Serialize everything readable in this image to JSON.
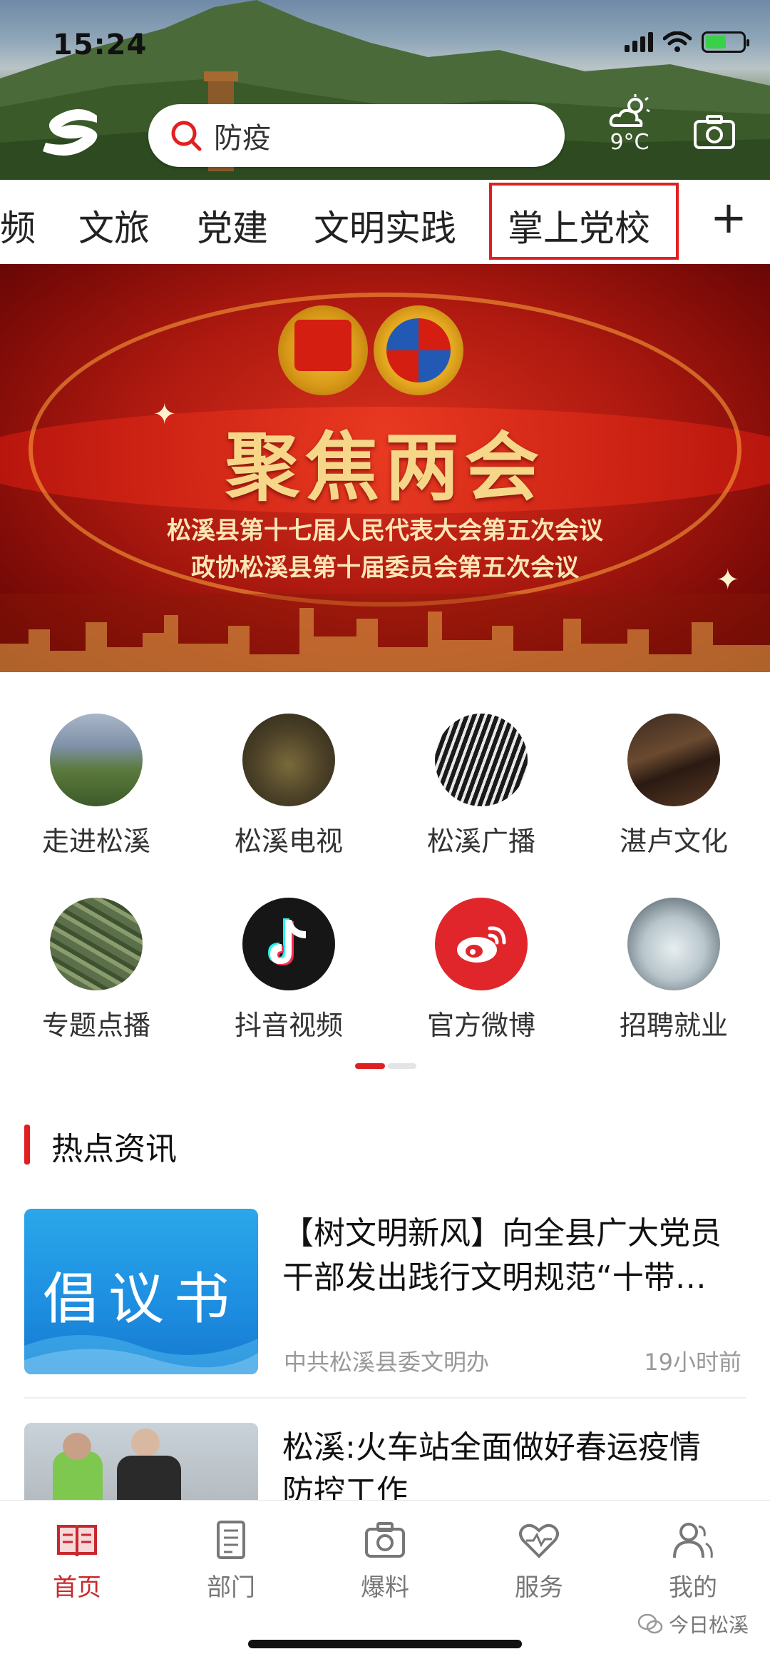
{
  "status_bar": {
    "time": "15:24"
  },
  "header": {
    "search_text": "防疫",
    "weather_temp": "9°C"
  },
  "tabs": {
    "items": [
      "频",
      "文旅",
      "党建",
      "文明实践",
      "掌上党校"
    ],
    "plus": "+"
  },
  "banner": {
    "title": "聚焦两会",
    "line1": "松溪县第十七届人民代表大会第五次会议",
    "line2": "政协松溪县第十届委员会第五次会议"
  },
  "quick_links": [
    {
      "label": "走进松溪"
    },
    {
      "label": "松溪电视"
    },
    {
      "label": "松溪广播"
    },
    {
      "label": "湛卢文化"
    },
    {
      "label": "专题点播"
    },
    {
      "label": "抖音视频"
    },
    {
      "label": "官方微博"
    },
    {
      "label": "招聘就业"
    }
  ],
  "hot_news": {
    "section_title": "热点资讯",
    "items": [
      {
        "image_text": "倡议书",
        "title_line1": "【树文明新风】向全县广大党员",
        "title_line2": "干部发出践行文明规范“十带…",
        "source": "中共松溪县委文明办",
        "time": "19小时前"
      },
      {
        "title_line1": "松溪:火车站全面做好春运疫情",
        "title_line2": "防控工作"
      }
    ]
  },
  "bottom_nav": [
    {
      "label": "首页",
      "icon": "book-icon",
      "active": true
    },
    {
      "label": "部门",
      "icon": "document-icon",
      "active": false
    },
    {
      "label": "爆料",
      "icon": "camera-icon",
      "active": false
    },
    {
      "label": "服务",
      "icon": "heart-icon",
      "active": false
    },
    {
      "label": "我的",
      "icon": "user-icon",
      "active": false
    }
  ],
  "watermark": "今日松溪",
  "colors": {
    "accent": "#e02020",
    "banner_red": "#b01a10",
    "gold": "#f6d78a"
  }
}
